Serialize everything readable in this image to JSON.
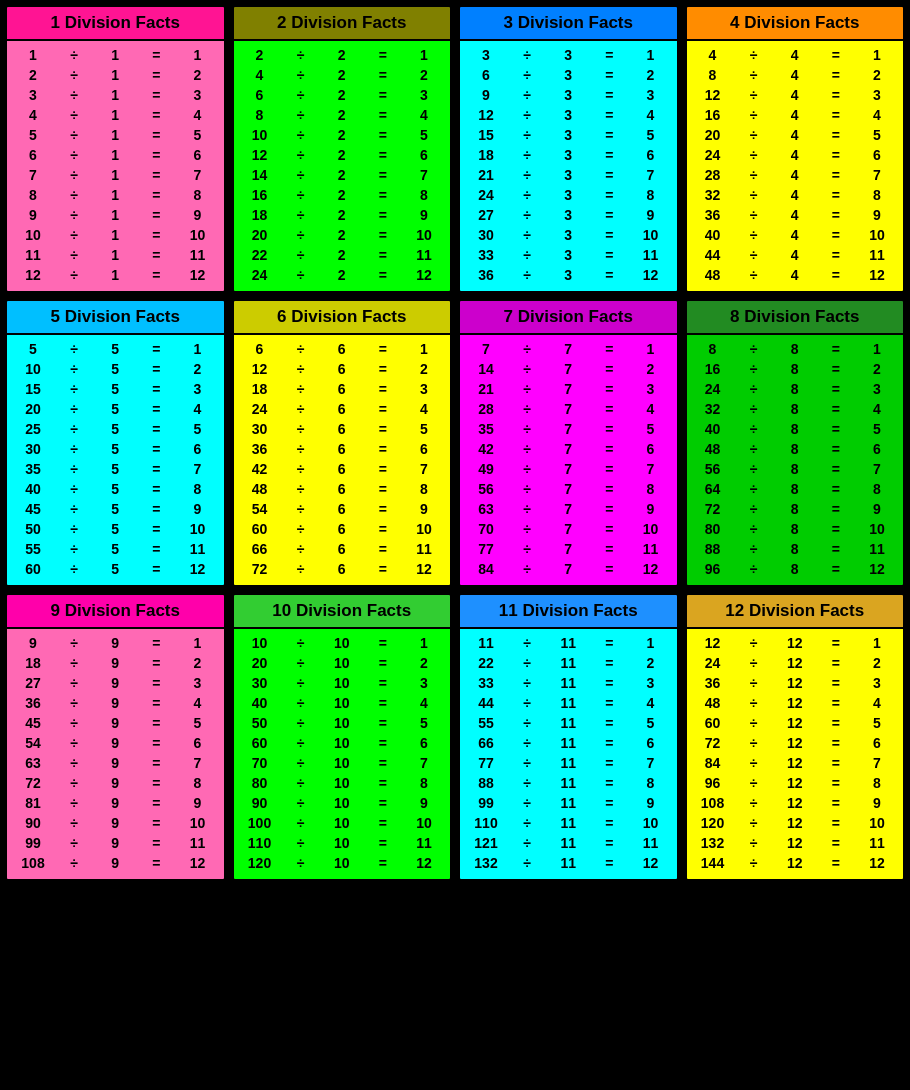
{
  "cards": [
    {
      "id": "1",
      "title": "1 Division Facts",
      "headerClass": "hdr-pink",
      "bodyClass": "bg-pink",
      "divisor": 1,
      "facts": [
        {
          "a": 1,
          "b": 1,
          "r": 1
        },
        {
          "a": 2,
          "b": 1,
          "r": 2
        },
        {
          "a": 3,
          "b": 1,
          "r": 3
        },
        {
          "a": 4,
          "b": 1,
          "r": 4
        },
        {
          "a": 5,
          "b": 1,
          "r": 5
        },
        {
          "a": 6,
          "b": 1,
          "r": 6
        },
        {
          "a": 7,
          "b": 1,
          "r": 7
        },
        {
          "a": 8,
          "b": 1,
          "r": 8
        },
        {
          "a": 9,
          "b": 1,
          "r": 9
        },
        {
          "a": 10,
          "b": 1,
          "r": 10
        },
        {
          "a": 11,
          "b": 1,
          "r": 11
        },
        {
          "a": 12,
          "b": 1,
          "r": 12
        }
      ]
    },
    {
      "id": "2",
      "title": "2 Division Facts",
      "headerClass": "hdr-olive",
      "bodyClass": "bg-green",
      "divisor": 2,
      "facts": [
        {
          "a": 2,
          "b": 2,
          "r": 1
        },
        {
          "a": 4,
          "b": 2,
          "r": 2
        },
        {
          "a": 6,
          "b": 2,
          "r": 3
        },
        {
          "a": 8,
          "b": 2,
          "r": 4
        },
        {
          "a": 10,
          "b": 2,
          "r": 5
        },
        {
          "a": 12,
          "b": 2,
          "r": 6
        },
        {
          "a": 14,
          "b": 2,
          "r": 7
        },
        {
          "a": 16,
          "b": 2,
          "r": 8
        },
        {
          "a": 18,
          "b": 2,
          "r": 9
        },
        {
          "a": 20,
          "b": 2,
          "r": 10
        },
        {
          "a": 22,
          "b": 2,
          "r": 11
        },
        {
          "a": 24,
          "b": 2,
          "r": 12
        }
      ]
    },
    {
      "id": "3",
      "title": "3 Division Facts",
      "headerClass": "hdr-blue",
      "bodyClass": "bg-cyan",
      "divisor": 3,
      "facts": [
        {
          "a": 3,
          "b": 3,
          "r": 1
        },
        {
          "a": 6,
          "b": 3,
          "r": 2
        },
        {
          "a": 9,
          "b": 3,
          "r": 3
        },
        {
          "a": 12,
          "b": 3,
          "r": 4
        },
        {
          "a": 15,
          "b": 3,
          "r": 5
        },
        {
          "a": 18,
          "b": 3,
          "r": 6
        },
        {
          "a": 21,
          "b": 3,
          "r": 7
        },
        {
          "a": 24,
          "b": 3,
          "r": 8
        },
        {
          "a": 27,
          "b": 3,
          "r": 9
        },
        {
          "a": 30,
          "b": 3,
          "r": 10
        },
        {
          "a": 33,
          "b": 3,
          "r": 11
        },
        {
          "a": 36,
          "b": 3,
          "r": 12
        }
      ]
    },
    {
      "id": "4",
      "title": "4 Division Facts",
      "headerClass": "hdr-orange",
      "bodyClass": "bg-yellow",
      "divisor": 4,
      "facts": [
        {
          "a": 4,
          "b": 4,
          "r": 1
        },
        {
          "a": 8,
          "b": 4,
          "r": 2
        },
        {
          "a": 12,
          "b": 4,
          "r": 3
        },
        {
          "a": 16,
          "b": 4,
          "r": 4
        },
        {
          "a": 20,
          "b": 4,
          "r": 5
        },
        {
          "a": 24,
          "b": 4,
          "r": 6
        },
        {
          "a": 28,
          "b": 4,
          "r": 7
        },
        {
          "a": 32,
          "b": 4,
          "r": 8
        },
        {
          "a": 36,
          "b": 4,
          "r": 9
        },
        {
          "a": 40,
          "b": 4,
          "r": 10
        },
        {
          "a": 44,
          "b": 4,
          "r": 11
        },
        {
          "a": 48,
          "b": 4,
          "r": 12
        }
      ]
    },
    {
      "id": "5",
      "title": "5 Division Facts",
      "headerClass": "hdr-cyan2",
      "bodyClass": "bg-cyan",
      "divisor": 5,
      "facts": [
        {
          "a": 5,
          "b": 5,
          "r": 1
        },
        {
          "a": 10,
          "b": 5,
          "r": 2
        },
        {
          "a": 15,
          "b": 5,
          "r": 3
        },
        {
          "a": 20,
          "b": 5,
          "r": 4
        },
        {
          "a": 25,
          "b": 5,
          "r": 5
        },
        {
          "a": 30,
          "b": 5,
          "r": 6
        },
        {
          "a": 35,
          "b": 5,
          "r": 7
        },
        {
          "a": 40,
          "b": 5,
          "r": 8
        },
        {
          "a": 45,
          "b": 5,
          "r": 9
        },
        {
          "a": 50,
          "b": 5,
          "r": 10
        },
        {
          "a": 55,
          "b": 5,
          "r": 11
        },
        {
          "a": 60,
          "b": 5,
          "r": 12
        }
      ]
    },
    {
      "id": "6",
      "title": "6 Division Facts",
      "headerClass": "hdr-yellow2",
      "bodyClass": "bg-yellow",
      "divisor": 6,
      "facts": [
        {
          "a": 6,
          "b": 6,
          "r": 1
        },
        {
          "a": 12,
          "b": 6,
          "r": 2
        },
        {
          "a": 18,
          "b": 6,
          "r": 3
        },
        {
          "a": 24,
          "b": 6,
          "r": 4
        },
        {
          "a": 30,
          "b": 6,
          "r": 5
        },
        {
          "a": 36,
          "b": 6,
          "r": 6
        },
        {
          "a": 42,
          "b": 6,
          "r": 7
        },
        {
          "a": 48,
          "b": 6,
          "r": 8
        },
        {
          "a": 54,
          "b": 6,
          "r": 9
        },
        {
          "a": 60,
          "b": 6,
          "r": 10
        },
        {
          "a": 66,
          "b": 6,
          "r": 11
        },
        {
          "a": 72,
          "b": 6,
          "r": 12
        }
      ]
    },
    {
      "id": "7",
      "title": "7 Division Facts",
      "headerClass": "hdr-magenta2",
      "bodyClass": "bg-magenta",
      "divisor": 7,
      "facts": [
        {
          "a": 7,
          "b": 7,
          "r": 1
        },
        {
          "a": 14,
          "b": 7,
          "r": 2
        },
        {
          "a": 21,
          "b": 7,
          "r": 3
        },
        {
          "a": 28,
          "b": 7,
          "r": 4
        },
        {
          "a": 35,
          "b": 7,
          "r": 5
        },
        {
          "a": 42,
          "b": 7,
          "r": 6
        },
        {
          "a": 49,
          "b": 7,
          "r": 7
        },
        {
          "a": 56,
          "b": 7,
          "r": 8
        },
        {
          "a": 63,
          "b": 7,
          "r": 9
        },
        {
          "a": 70,
          "b": 7,
          "r": 10
        },
        {
          "a": 77,
          "b": 7,
          "r": 11
        },
        {
          "a": 84,
          "b": 7,
          "r": 12
        }
      ]
    },
    {
      "id": "8",
      "title": "8 Division Facts",
      "headerClass": "hdr-green3",
      "bodyClass": "bg-green2",
      "divisor": 8,
      "facts": [
        {
          "a": 8,
          "b": 8,
          "r": 1
        },
        {
          "a": 16,
          "b": 8,
          "r": 2
        },
        {
          "a": 24,
          "b": 8,
          "r": 3
        },
        {
          "a": 32,
          "b": 8,
          "r": 4
        },
        {
          "a": 40,
          "b": 8,
          "r": 5
        },
        {
          "a": 48,
          "b": 8,
          "r": 6
        },
        {
          "a": 56,
          "b": 8,
          "r": 7
        },
        {
          "a": 64,
          "b": 8,
          "r": 8
        },
        {
          "a": 72,
          "b": 8,
          "r": 9
        },
        {
          "a": 80,
          "b": 8,
          "r": 10
        },
        {
          "a": 88,
          "b": 8,
          "r": 11
        },
        {
          "a": 96,
          "b": 8,
          "r": 12
        }
      ]
    },
    {
      "id": "9",
      "title": "9 Division Facts",
      "headerClass": "hdr-magenta3",
      "bodyClass": "bg-pink",
      "divisor": 9,
      "facts": [
        {
          "a": 9,
          "b": 9,
          "r": 1
        },
        {
          "a": 18,
          "b": 9,
          "r": 2
        },
        {
          "a": 27,
          "b": 9,
          "r": 3
        },
        {
          "a": 36,
          "b": 9,
          "r": 4
        },
        {
          "a": 45,
          "b": 9,
          "r": 5
        },
        {
          "a": 54,
          "b": 9,
          "r": 6
        },
        {
          "a": 63,
          "b": 9,
          "r": 7
        },
        {
          "a": 72,
          "b": 9,
          "r": 8
        },
        {
          "a": 81,
          "b": 9,
          "r": 9
        },
        {
          "a": 90,
          "b": 9,
          "r": 10
        },
        {
          "a": 99,
          "b": 9,
          "r": 11
        },
        {
          "a": 108,
          "b": 9,
          "r": 12
        }
      ]
    },
    {
      "id": "10",
      "title": "10 Division Facts",
      "headerClass": "hdr-green4",
      "bodyClass": "bg-green",
      "divisor": 10,
      "facts": [
        {
          "a": 10,
          "b": 10,
          "r": 1
        },
        {
          "a": 20,
          "b": 10,
          "r": 2
        },
        {
          "a": 30,
          "b": 10,
          "r": 3
        },
        {
          "a": 40,
          "b": 10,
          "r": 4
        },
        {
          "a": 50,
          "b": 10,
          "r": 5
        },
        {
          "a": 60,
          "b": 10,
          "r": 6
        },
        {
          "a": 70,
          "b": 10,
          "r": 7
        },
        {
          "a": 80,
          "b": 10,
          "r": 8
        },
        {
          "a": 90,
          "b": 10,
          "r": 9
        },
        {
          "a": 100,
          "b": 10,
          "r": 10
        },
        {
          "a": 110,
          "b": 10,
          "r": 11
        },
        {
          "a": 120,
          "b": 10,
          "r": 12
        }
      ]
    },
    {
      "id": "11",
      "title": "11 Division Facts",
      "headerClass": "hdr-blue2",
      "bodyClass": "bg-cyan",
      "divisor": 11,
      "facts": [
        {
          "a": 11,
          "b": 11,
          "r": 1
        },
        {
          "a": 22,
          "b": 11,
          "r": 2
        },
        {
          "a": 33,
          "b": 11,
          "r": 3
        },
        {
          "a": 44,
          "b": 11,
          "r": 4
        },
        {
          "a": 55,
          "b": 11,
          "r": 5
        },
        {
          "a": 66,
          "b": 11,
          "r": 6
        },
        {
          "a": 77,
          "b": 11,
          "r": 7
        },
        {
          "a": 88,
          "b": 11,
          "r": 8
        },
        {
          "a": 99,
          "b": 11,
          "r": 9
        },
        {
          "a": 110,
          "b": 11,
          "r": 10
        },
        {
          "a": 121,
          "b": 11,
          "r": 11
        },
        {
          "a": 132,
          "b": 11,
          "r": 12
        }
      ]
    },
    {
      "id": "12",
      "title": "12 Division Facts",
      "headerClass": "hdr-gold",
      "bodyClass": "bg-yellow",
      "divisor": 12,
      "facts": [
        {
          "a": 12,
          "b": 12,
          "r": 1
        },
        {
          "a": 24,
          "b": 12,
          "r": 2
        },
        {
          "a": 36,
          "b": 12,
          "r": 3
        },
        {
          "a": 48,
          "b": 12,
          "r": 4
        },
        {
          "a": 60,
          "b": 12,
          "r": 5
        },
        {
          "a": 72,
          "b": 12,
          "r": 6
        },
        {
          "a": 84,
          "b": 12,
          "r": 7
        },
        {
          "a": 96,
          "b": 12,
          "r": 8
        },
        {
          "a": 108,
          "b": 12,
          "r": 9
        },
        {
          "a": 120,
          "b": 12,
          "r": 10
        },
        {
          "a": 132,
          "b": 12,
          "r": 11
        },
        {
          "a": 144,
          "b": 12,
          "r": 12
        }
      ]
    }
  ]
}
